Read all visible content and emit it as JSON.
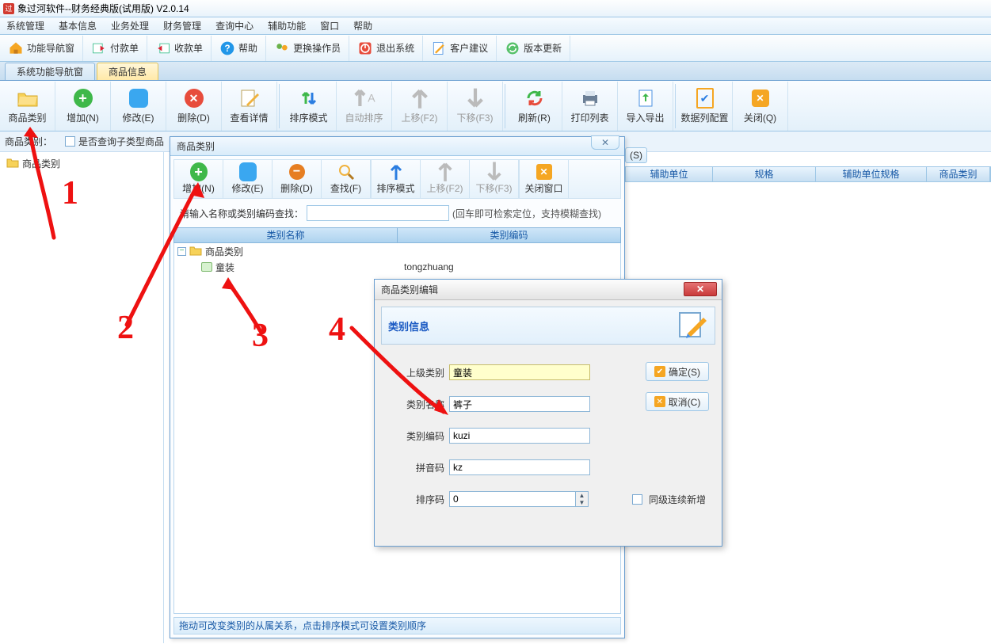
{
  "app": {
    "title": "象过河软件--财务经典版(试用版) V2.0.14"
  },
  "menu": [
    "系统管理",
    "基本信息",
    "业务处理",
    "财务管理",
    "查询中心",
    "辅助功能",
    "窗口",
    "帮助"
  ],
  "mainToolbar": [
    {
      "k": "nav",
      "label": "功能导航窗"
    },
    {
      "k": "pay",
      "label": "付款单"
    },
    {
      "k": "recv",
      "label": "收款单"
    },
    {
      "k": "help",
      "label": "帮助"
    },
    {
      "k": "oper",
      "label": "更换操作员"
    },
    {
      "k": "exit",
      "label": "退出系统"
    },
    {
      "k": "sugg",
      "label": "客户建议"
    },
    {
      "k": "upd",
      "label": "版本更新"
    }
  ],
  "tabs": {
    "t1": "系统功能导航窗",
    "t2": "商品信息"
  },
  "subToolbar": {
    "cat": "商品类别",
    "add": "增加(N)",
    "edit": "修改(E)",
    "del": "删除(D)",
    "detail": "查看详情",
    "sort": "排序模式",
    "autosort": "自动排序",
    "up": "上移(F2)",
    "down": "下移(F3)",
    "refresh": "刷新(R)",
    "print": "打印列表",
    "io": "导入导出",
    "cfg": "数据列配置",
    "close": "关闭(Q)"
  },
  "filter": {
    "label": "商品类别：",
    "chkLabel": "是否查询子类型商品"
  },
  "leftTree": {
    "root": "商品类别"
  },
  "gridHeaders": [
    "辅助单位",
    "规格",
    "辅助单位规格",
    "商品类别"
  ],
  "gridSideBtn": "(S)",
  "catWin": {
    "title": "商品类别",
    "closeX": "✕",
    "tb": {
      "add": "增加(N)",
      "edit": "修改(E)",
      "del": "删除(D)",
      "find": "查找(F)",
      "sort": "排序模式",
      "up": "上移(F2)",
      "down": "下移(F3)",
      "close": "关闭窗口"
    },
    "searchLabel": "请输入名称或类别编码查找：",
    "searchHint": "(回车即可检索定位，支持模糊查找)",
    "listHeaders": [
      "类别名称",
      "类别编码"
    ],
    "tree": [
      {
        "name": "商品类别",
        "code": ""
      },
      {
        "name": "童装",
        "code": "tongzhuang"
      }
    ],
    "footer": "拖动可改变类别的从属关系，点击排序模式可设置类别顺序"
  },
  "editDlg": {
    "title": "商品类别编辑",
    "headerTitle": "类别信息",
    "closeX": "✕",
    "fields": {
      "parentLabel": "上级类别",
      "parentVal": "童装",
      "nameLabel": "类别名称",
      "nameVal": "裤子",
      "codeLabel": "类别编码",
      "codeVal": "kuzi",
      "pinyinLabel": "拼音码",
      "pinyinVal": "kz",
      "orderLabel": "排序码",
      "orderVal": "0"
    },
    "okBtn": "确定(S)",
    "cancelBtn": "取消(C)",
    "chkLabel": "同级连续新增"
  },
  "annotations": {
    "n1": "1",
    "n2": "2",
    "n3": "3",
    "n4": "4"
  }
}
